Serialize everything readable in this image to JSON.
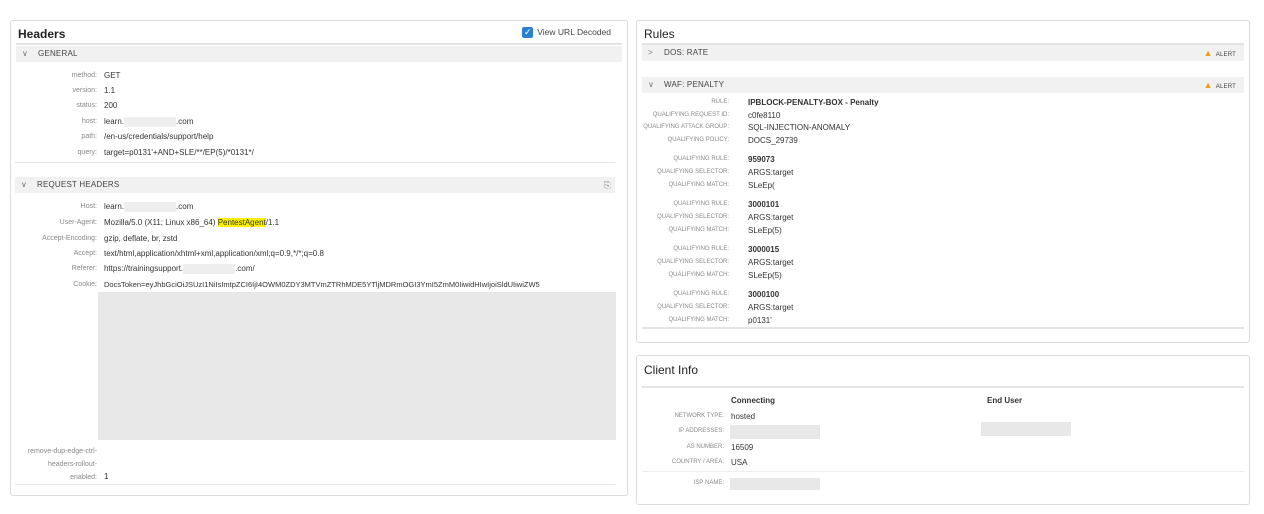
{
  "headers": {
    "title": "Headers",
    "view_url_decoded": {
      "label": "View URL Decoded",
      "checked": true
    },
    "general": {
      "label": "GENERAL",
      "rows": [
        {
          "k": "method:",
          "v": "GET"
        },
        {
          "k": "version:",
          "v": "1.1"
        },
        {
          "k": "status:",
          "v": "200"
        },
        {
          "k": "host:",
          "v1": "learn.",
          "v2": ".com"
        },
        {
          "k": "path:",
          "v": "/en-us/credentials/support/help"
        },
        {
          "k": "query:",
          "v": "target=p0131'+AND+SLE/**/EP(5)/*0131*/"
        }
      ]
    },
    "request_headers": {
      "label": "REQUEST HEADERS",
      "rows": [
        {
          "k": "Host:",
          "v1": "learn.",
          "v2": ".com"
        },
        {
          "k": "User-Agent:",
          "v1": "Mozilla/5.0 (X11; Linux x86_64) ",
          "hl": "PentestAgent",
          "v2": "/1.1"
        },
        {
          "k": "Accept-Encoding:",
          "v": "gzip, deflate, br, zstd"
        },
        {
          "k": "Accept:",
          "v": "text/html,application/xhtml+xml,application/xml;q=0.9,*/*;q=0.8"
        },
        {
          "k": "Referer:",
          "v1": "https://trainingsupport.",
          "v2": ".com/"
        },
        {
          "k": "Cookie:",
          "v": "DocsToken=eyJhbGciOiJSUzI1NiIsImtpZCI6IjI4OWM0ZDY3MTVmZTRhMDE5YTljMDRmOGI3YmI5ZmM0IiwidHIwIjoiSldUIiwiZW5"
        },
        {
          "k1": "remove-dup-edge-ctrl-",
          "k2": "headers-rollout-",
          "k3": "enabled:",
          "v": "1"
        }
      ]
    }
  },
  "rules": {
    "title": "Rules",
    "sections": [
      {
        "label": "DOS: RATE",
        "expanded": false,
        "badge": "ALERT"
      },
      {
        "label": "WAF: PENALTY",
        "expanded": true,
        "badge": "ALERT"
      }
    ],
    "waf": {
      "rule_label": "RULE:",
      "rule": "IPBLOCK-PENALTY-BOX - Penalty",
      "req_id_label": "QUALIFYING REQUEST ID:",
      "req_id": "c0fe8110",
      "group_label": "QUALIFYING ATTACK GROUP:",
      "group": "SQL-INJECTION-ANOMALY",
      "policy_label": "QUALIFYING POLICY:",
      "policy": "DOCS_29739",
      "qr_label": "QUALIFYING RULE:",
      "qs_label": "QUALIFYING SELECTOR:",
      "qm_label": "QUALIFYING MATCH:",
      "matches": [
        {
          "rule": "959073",
          "selector": "ARGS:target",
          "match": "SLeEp("
        },
        {
          "rule": "3000101",
          "selector": "ARGS:target",
          "match": "SLeEp(5)"
        },
        {
          "rule": "3000015",
          "selector": "ARGS:target",
          "match": "SLeEp(5)"
        },
        {
          "rule": "3000100",
          "selector": "ARGS:target",
          "match": "p0131'"
        }
      ]
    }
  },
  "client_info": {
    "title": "Client Info",
    "col_connecting": "Connecting",
    "col_end_user": "End User",
    "network_type_label": "NETWORK TYPE:",
    "network_type": "hosted",
    "ip_label": "IP ADDRESSES:",
    "as_label": "AS NUMBER:",
    "as_number": "16509",
    "country_label": "COUNTRY / AREA:",
    "country": "USA",
    "isp_label": "ISP NAME:"
  },
  "colors": {
    "highlight": "#fff200",
    "alert": "#e8a317",
    "checkbox": "#2f7fd1"
  }
}
